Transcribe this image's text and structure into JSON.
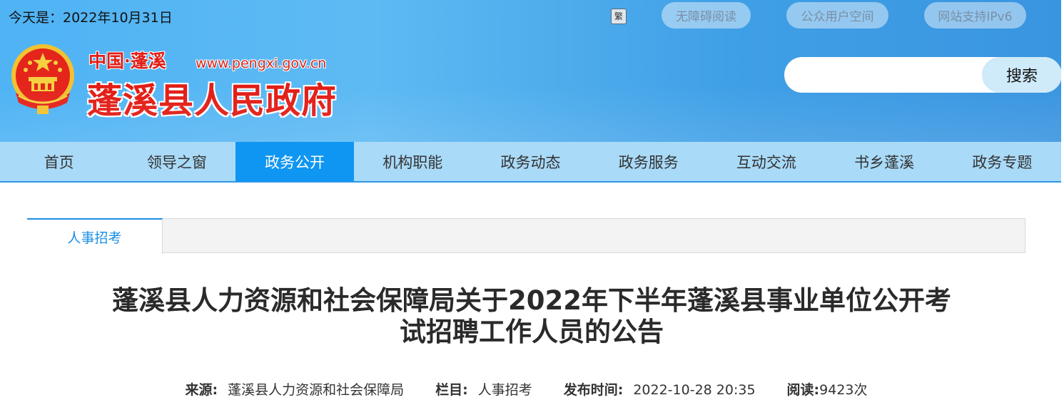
{
  "header": {
    "date_text": "今天是：2022年10月31日",
    "font_switch": "繁",
    "pills": [
      "无障碍阅读",
      "公众用户空间",
      "网站支持IPv6"
    ],
    "site_small": "中国·蓬溪",
    "site_url": "www.pengxi.gov.cn",
    "site_big": "蓬溪县人民政府",
    "search_placeholder": "",
    "search_button": "搜索",
    "emblem_icon": "national-emblem-icon"
  },
  "nav": {
    "items": [
      "首页",
      "领导之窗",
      "政务公开",
      "机构职能",
      "政务动态",
      "政务服务",
      "互动交流",
      "书乡蓬溪",
      "政务专题"
    ],
    "active_index": 2
  },
  "content": {
    "tab_label": "人事招考",
    "title_line1": "蓬溪县人力资源和社会保障局关于2022年下半年蓬溪县事业单位公开考",
    "title_line2": "试招聘工作人员的公告",
    "meta": {
      "source_label": "来源:",
      "source_value": "蓬溪县人力资源和社会保障局",
      "column_label": "栏目:",
      "column_value": "人事招考",
      "time_label": "发布时间:",
      "time_value": "2022-10-28 20:35",
      "read_label": "阅读:",
      "read_value": "9423次"
    }
  },
  "colors": {
    "accent_blue": "#0f96f2",
    "nav_bg": "#a9daf8",
    "logo_red": "#e21d16",
    "tab_blue": "#1b8ee6"
  }
}
